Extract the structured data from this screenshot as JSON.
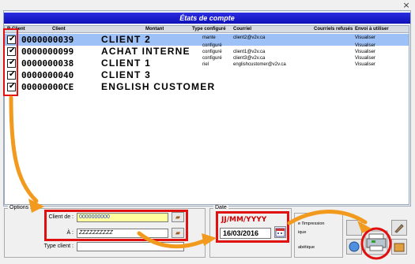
{
  "window": {
    "close_glyph": "×"
  },
  "title": "États de compte",
  "columns": {
    "check": "R",
    "client": "Client",
    "client2": "Client",
    "montant": "Montant",
    "type": "Type configuré",
    "courriel": "Courriel",
    "refuses": "Courriels refusés",
    "envoi": "Envoi à utiliser"
  },
  "rows": [
    {
      "code": "0000000039",
      "name": "CLIENT 2",
      "type": "mante",
      "email": "client2@v2v.ca",
      "envoi": "Visualiser",
      "selected": true
    },
    {
      "code": "0000000099",
      "name": "ACHAT INTERNE",
      "type": "configuré",
      "email": "",
      "envoi": "Visualiser",
      "selected": false
    },
    {
      "code": "0000000038",
      "name": "CLIENT 1",
      "type": "configuré",
      "email": "client1@v2v.ca",
      "envoi": "Visualiser",
      "selected": false
    },
    {
      "code": "0000000040",
      "name": "CLIENT 3",
      "type": "configuré",
      "email": "client3@v2v.ca",
      "envoi": "Visualiser",
      "selected": false
    },
    {
      "code": "00000000CE",
      "name": "ENGLISH CUSTOMER",
      "type": "riel",
      "email": "englishcustomer@v2v.ca",
      "envoi": "Visualiser",
      "selected": false
    }
  ],
  "options": {
    "group_label": "Options",
    "client_from_label": "Client de :",
    "client_from_value": "0000000000",
    "client_to_label": "À :",
    "client_to_value": "ZZZZZZZZZZ",
    "type_label": "Type client :",
    "type_value": ""
  },
  "date": {
    "group_label": "Date",
    "format_hint": "JJ/MM/YYYY",
    "value": "16/03/2016"
  },
  "print_panel": {
    "line1": "e l'impression",
    "line2": "ique",
    "line3": "abétique"
  },
  "colors": {
    "title_bg": "#1a1ad0",
    "selected_row": "#9dc0f7",
    "highlight_red": "#e01010",
    "arrow_orange": "#f29a1e",
    "input_yellow": "#ffffa0"
  },
  "icons": {
    "browse": "folder-browse-icon",
    "calendar": "calendar-icon",
    "print": "printer-icon"
  }
}
